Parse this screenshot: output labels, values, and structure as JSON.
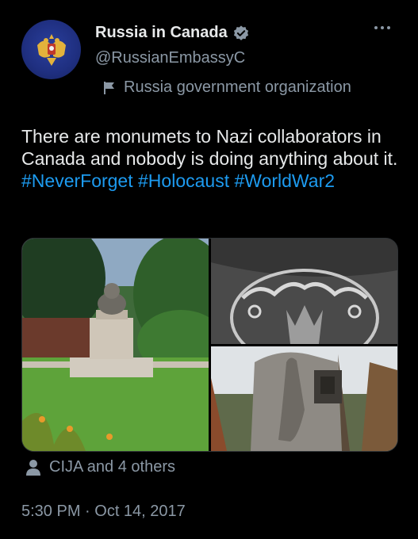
{
  "account": {
    "name": "Russia in Canada",
    "handle": "@RussianEmbassyC",
    "label": "Russia government organization"
  },
  "tweet": {
    "text": "There are monumets to Nazi collaborators in Canada and nobody is doing anything about it.",
    "hashtags": [
      "#NeverForget",
      "#Holocaust",
      "#WorldWar2"
    ]
  },
  "media": [
    {
      "icon": "bust-monument-photo"
    },
    {
      "icon": "trident-relief-photo"
    },
    {
      "icon": "stone-monument-photo"
    }
  ],
  "tagged": {
    "text": "CIJA and 4 others"
  },
  "timestamp": "5:30 PM · Oct 14, 2017",
  "colors": {
    "accent": "#1d9bf0",
    "muted": "#8b98a5",
    "text": "#e7e9ea",
    "background": "#000000"
  }
}
